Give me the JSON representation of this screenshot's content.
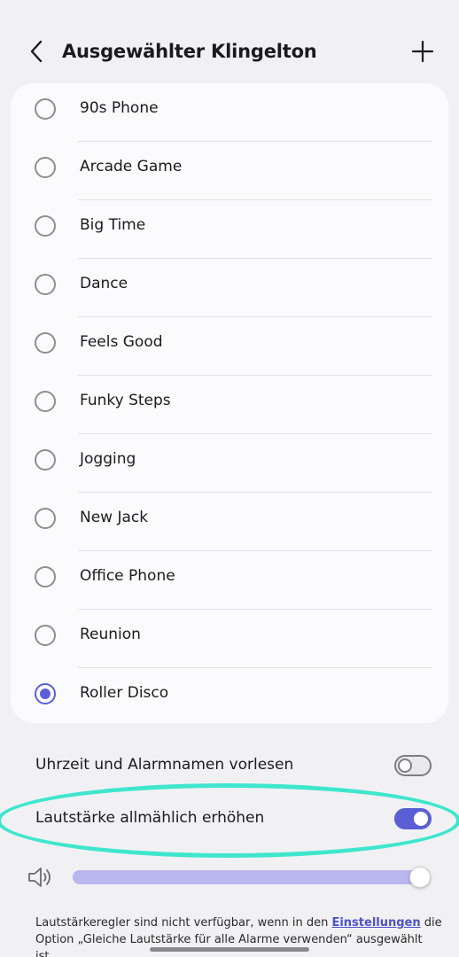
{
  "header": {
    "title": "Ausgewählter Klingelton",
    "back_icon": "chevron-left-icon",
    "add_icon": "plus-icon"
  },
  "ringtones": [
    {
      "label": "90s Phone",
      "selected": false
    },
    {
      "label": "Arcade Game",
      "selected": false
    },
    {
      "label": "Big Time",
      "selected": false
    },
    {
      "label": "Dance",
      "selected": false
    },
    {
      "label": "Feels Good",
      "selected": false
    },
    {
      "label": "Funky Steps",
      "selected": false
    },
    {
      "label": "Jogging",
      "selected": false
    },
    {
      "label": "New Jack",
      "selected": false
    },
    {
      "label": "Office Phone",
      "selected": false
    },
    {
      "label": "Reunion",
      "selected": false
    },
    {
      "label": "Roller Disco",
      "selected": true
    }
  ],
  "settings": {
    "read_aloud": {
      "label": "Uhrzeit und Alarmnamen vorlesen",
      "on": false
    },
    "gradual_volume": {
      "label": "Lautstärke allmählich erhöhen",
      "on": true
    }
  },
  "volume": {
    "icon": "speaker-icon",
    "level": 1.0
  },
  "note": {
    "before": "Lautstärkeregler sind nicht verfügbar, wenn in den ",
    "link": "Einstellungen",
    "after": " die Option „Gleiche Lautstärke für alle Alarme verwenden“ ausgewählt ist."
  },
  "colors": {
    "accent": "#5a5fd6",
    "highlight": "#3ee6cd",
    "background": "#f1f1f3",
    "card": "#fbfbfd"
  }
}
